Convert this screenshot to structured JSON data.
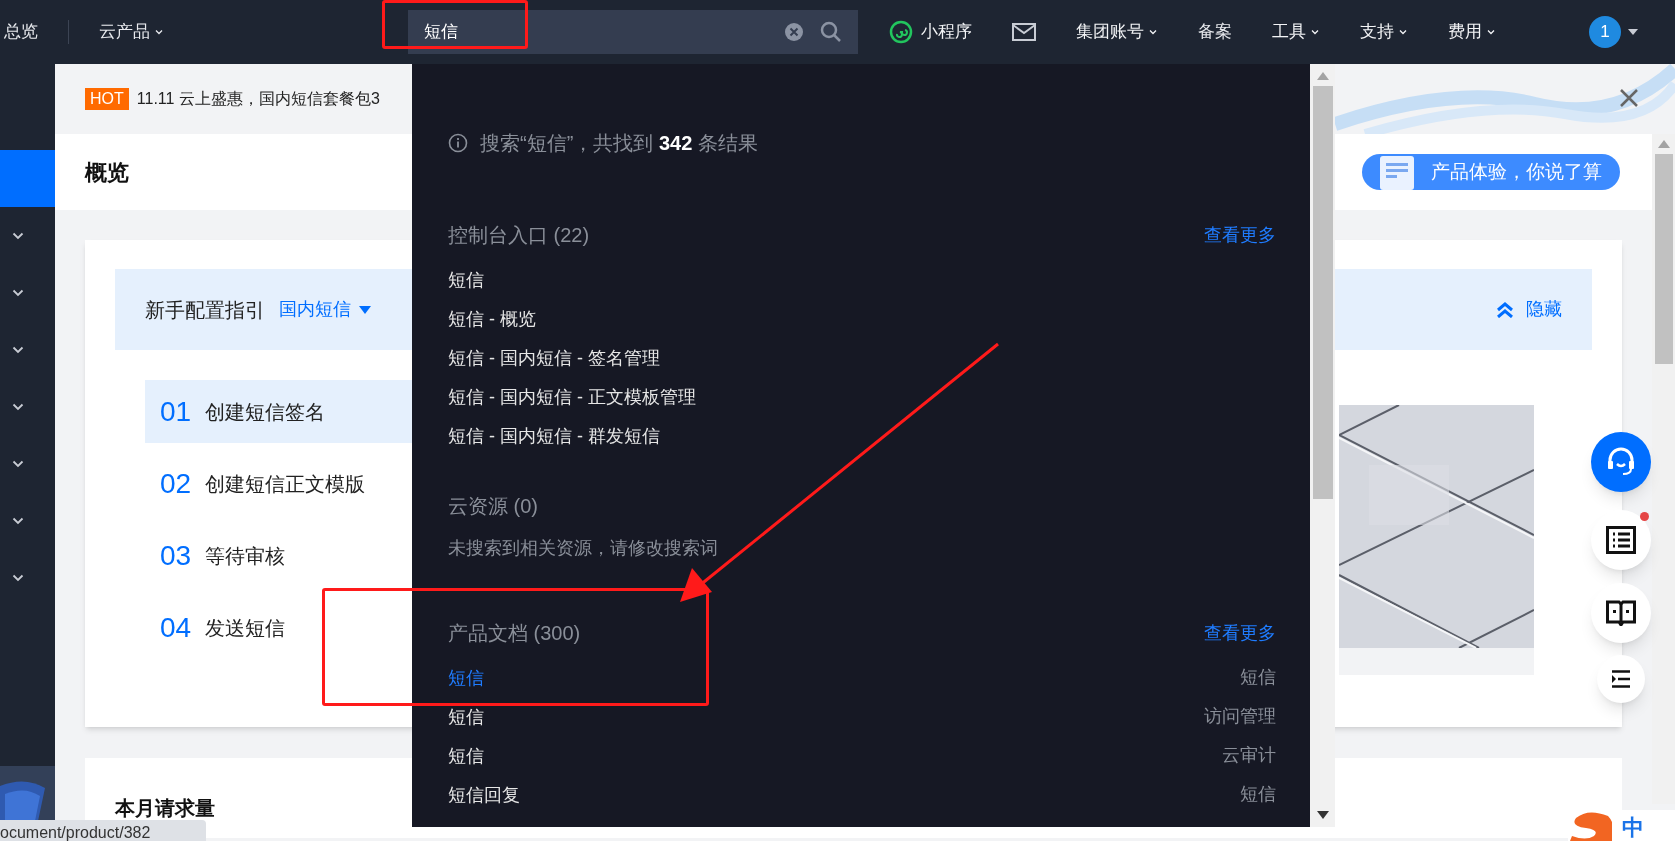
{
  "top_nav": {
    "overview": "总览",
    "products": "云产品",
    "search": {
      "value": "短信"
    },
    "right_items": [
      {
        "kind": "miniprogram",
        "label": "小程序"
      },
      {
        "kind": "mail"
      },
      {
        "kind": "menu",
        "label": "集团账号"
      },
      {
        "kind": "link",
        "label": "备案"
      },
      {
        "kind": "menu",
        "label": "工具"
      },
      {
        "kind": "menu",
        "label": "支持"
      },
      {
        "kind": "menu",
        "label": "费用"
      }
    ],
    "avatar": "1"
  },
  "sidebar": {
    "items": [
      {
        "selected": true
      },
      {
        "selected": false
      },
      {
        "selected": false
      },
      {
        "selected": false
      },
      {
        "selected": false
      },
      {
        "selected": false
      },
      {
        "selected": false
      },
      {
        "selected": false
      }
    ]
  },
  "banner": {
    "badge": "HOT",
    "text": "11.11 云上盛惠，国内短信套餐包3"
  },
  "page_header": {
    "title": "概览",
    "promo": "产品体验，你说了算"
  },
  "guide": {
    "title": "新手配置指引",
    "dropdown": "国内短信",
    "hide": "隐藏",
    "steps": [
      {
        "number": "01",
        "label": "创建短信签名",
        "selected": true
      },
      {
        "number": "02",
        "label": "创建短信正文模版",
        "selected": false
      },
      {
        "number": "03",
        "label": "等待审核",
        "selected": false
      },
      {
        "number": "04",
        "label": "发送短信",
        "selected": false
      }
    ]
  },
  "usage_card": {
    "title": "本月请求量"
  },
  "search_results": {
    "summary": "搜索“短信”，共找到 **342** 条结果",
    "sections": [
      {
        "title": "控制台入口 (22)",
        "more": "查看更多",
        "items": [
          {
            "label": "短信",
            "selected": false
          },
          {
            "label": "短信 - 概览",
            "selected": false
          },
          {
            "label": "短信 - 国内短信 - 签名管理",
            "selected": false
          },
          {
            "label": "短信 - 国内短信 - 正文模板管理",
            "selected": false
          },
          {
            "label": "短信 - 国内短信 - 群发短信",
            "selected": false
          }
        ]
      },
      {
        "title": "云资源 (0)",
        "empty": "未搜索到相关资源，请修改搜索词"
      },
      {
        "title": "产品文档 (300)",
        "more": "查看更多",
        "items": [
          {
            "label": "短信",
            "category": "短信",
            "selected": true
          },
          {
            "label": "短信",
            "category": "访问管理",
            "selected": false
          },
          {
            "label": "短信",
            "category": "云审计",
            "selected": false
          },
          {
            "label": "短信回复",
            "category": "短信",
            "selected": false
          }
        ]
      }
    ]
  },
  "float_buttons": [
    {
      "kind": "support",
      "notification": false
    },
    {
      "kind": "list",
      "notification": true
    },
    {
      "kind": "book",
      "notification": false
    },
    {
      "kind": "outline",
      "notification": false
    }
  ],
  "status_url": "ocument/product/382",
  "ime": {
    "label": "中"
  }
}
